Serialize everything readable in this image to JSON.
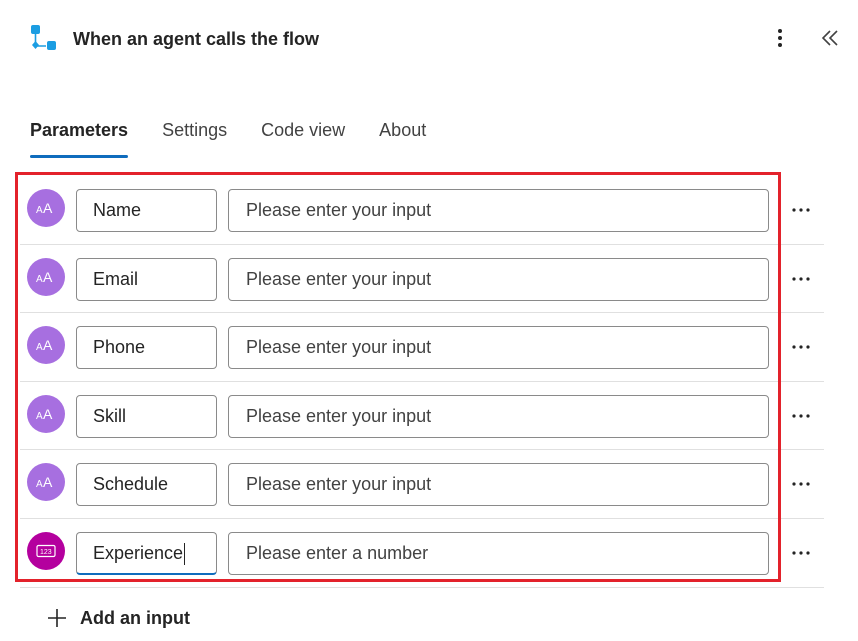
{
  "header": {
    "title": "When an agent calls the flow",
    "icon": "flow-trigger-icon",
    "more_icon": "more-vertical-icon",
    "collapse_icon": "double-chevron-left-icon"
  },
  "tabs": [
    {
      "label": "Parameters",
      "active": true
    },
    {
      "label": "Settings",
      "active": false
    },
    {
      "label": "Code view",
      "active": false
    },
    {
      "label": "About",
      "active": false
    }
  ],
  "parameters": [
    {
      "name": "Name",
      "placeholder": "Please enter your input",
      "type": "text",
      "icon": "text-type-icon"
    },
    {
      "name": "Email",
      "placeholder": "Please enter your input",
      "type": "text",
      "icon": "text-type-icon"
    },
    {
      "name": "Phone",
      "placeholder": "Please enter your input",
      "type": "text",
      "icon": "text-type-icon"
    },
    {
      "name": "Skill",
      "placeholder": "Please enter your input",
      "type": "text",
      "icon": "text-type-icon"
    },
    {
      "name": "Schedule",
      "placeholder": "Please enter your input",
      "type": "text",
      "icon": "text-type-icon"
    },
    {
      "name": "Experience",
      "placeholder": "Please enter a number",
      "type": "number",
      "icon": "number-type-icon"
    }
  ],
  "add_input_label": "Add an input",
  "colors": {
    "accent": "#0f6cbd",
    "text_avatar": "#a76fe0",
    "number_avatar": "#b4009e",
    "highlight": "#e3222b",
    "flow_icon": "#1b9de2"
  }
}
